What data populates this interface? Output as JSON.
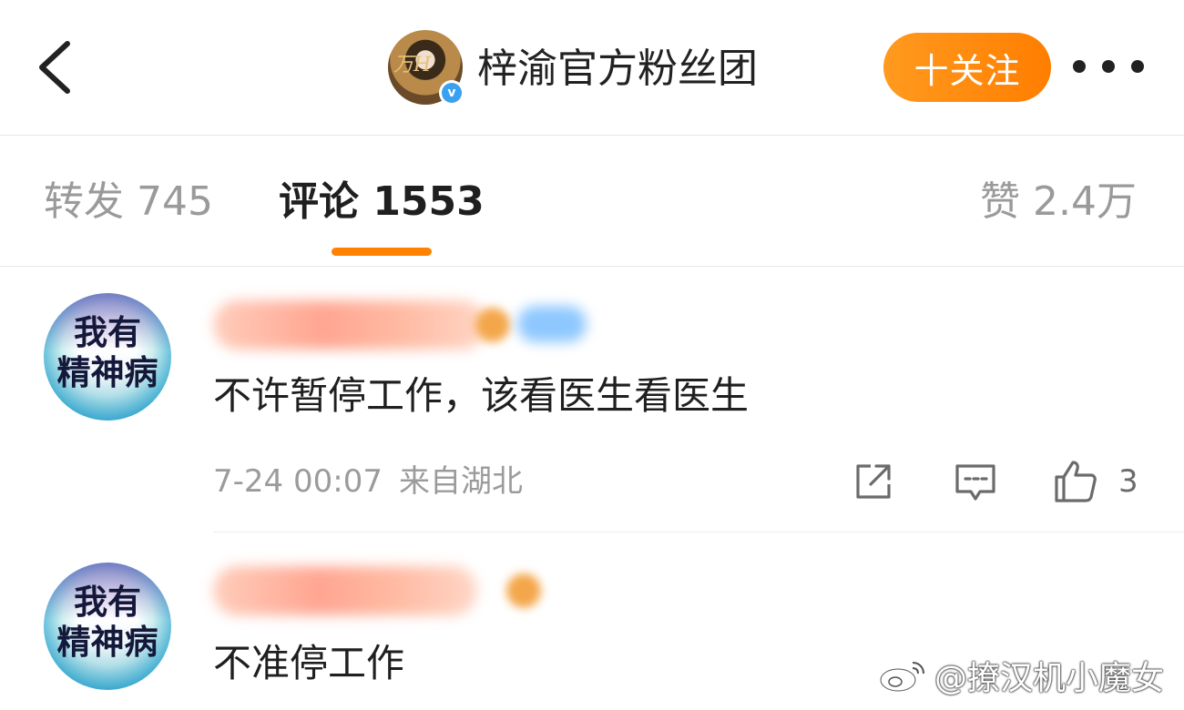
{
  "header": {
    "account_name": "梓渝官方粉丝团",
    "follow_label": "十关注",
    "avatar_deco_text": "万H",
    "verified_mark": "v"
  },
  "tabs": {
    "repost": "转发 745",
    "comments": "评论 1553",
    "likes": "赞 2.4万"
  },
  "comments": [
    {
      "avatar_text": [
        "我有",
        "精神病"
      ],
      "text": "不许暂停工作，该看医生看医生",
      "date": "7-24 00:07",
      "location": "来自湖北",
      "like_count": "3"
    },
    {
      "avatar_text": [
        "我有",
        "精神病"
      ],
      "text": "不准停工作"
    }
  ],
  "watermark": {
    "text": "@撩汉机小魔女"
  },
  "colors": {
    "accent": "#ff8200",
    "follow_button": "#ff9a1f",
    "muted_text": "#9b9b9b"
  }
}
